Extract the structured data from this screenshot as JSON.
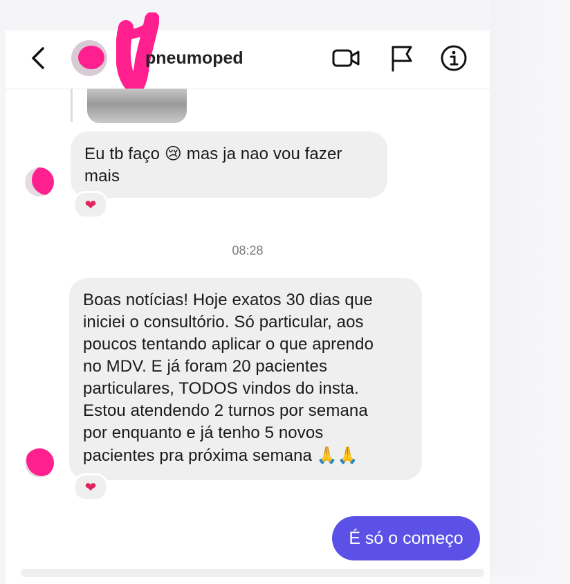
{
  "header": {
    "username": "pneumoped"
  },
  "messages": [
    {
      "text": "Eu tb faço 😢 mas ja nao vou fazer mais",
      "reaction": "❤"
    },
    {
      "text": "Boas notícias! Hoje exatos 30 dias que iniciei o consultório. Só particular, aos poucos tentando aplicar o que aprendo no MDV. E já foram 20 pacientes particulares, TODOS vindos do insta. Estou atendendo 2 turnos por semana por enquanto e já tenho 5 novos pacientes pra próxima semana 🙏🙏",
      "reaction": "❤"
    }
  ],
  "msg1": {
    "part1": "Eu tb faço ",
    "emoji": "😢",
    "part2": " mas ja nao vou fazer",
    "part3": "mais"
  },
  "msg2": {
    "lines": [
      "Boas notícias! Hoje exatos 30 dias que",
      "iniciei o consultório. Só particular, aos",
      "poucos tentando aplicar o que aprendo",
      "no MDV. E já foram 20 pacientes",
      "particulares, TODOS vindos do insta.",
      "Estou atendendo 2 turnos por semana",
      "por enquanto e já tenho 5 novos",
      "pacientes pra próxima semana"
    ],
    "emoji": "🙏🙏"
  },
  "timestamp": "08:28",
  "sent": {
    "text": "É só o começo"
  },
  "colors": {
    "sent_bubble": "#5b51e6",
    "received_bubble": "#efefef",
    "redaction": "#ff1f8e",
    "reaction": "#e0245e"
  },
  "icons": [
    "back-arrow-icon",
    "video-call-icon",
    "flag-icon",
    "info-icon",
    "heart-icon"
  ]
}
